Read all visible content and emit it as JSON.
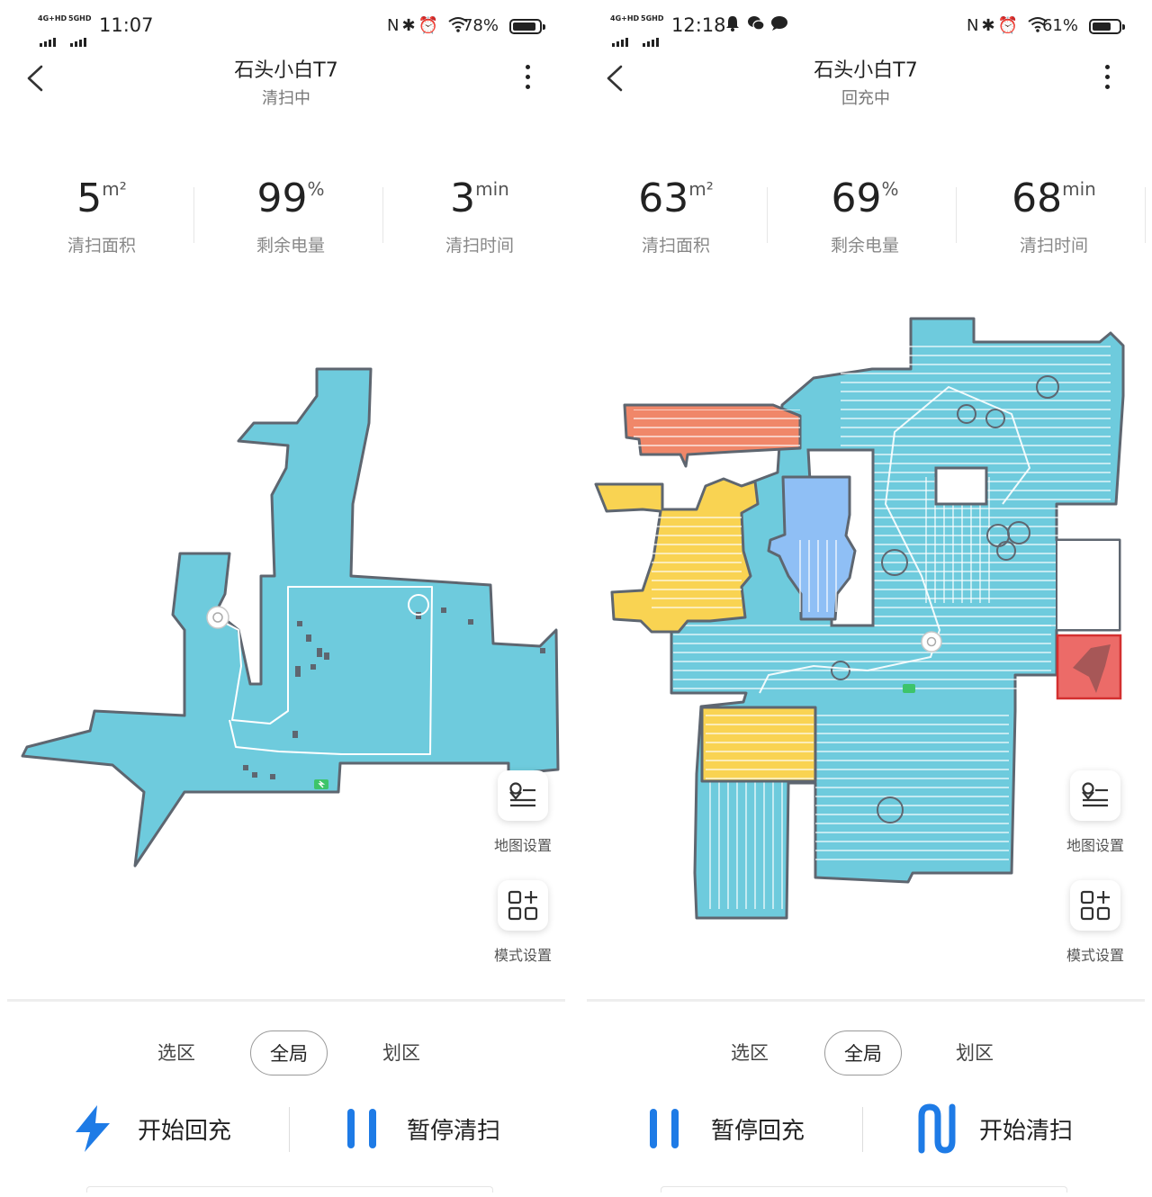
{
  "colors": {
    "accent_blue": "#1e7be6",
    "map_blue": "#6ecbdd",
    "map_wall": "#5e6670",
    "room_orange": "#f08769",
    "room_yellow": "#f9d352",
    "room_lightblue": "#8fbff5",
    "zone_red": "#e53935"
  },
  "panels": [
    {
      "status": {
        "net1": "4G+HD",
        "net2": "5GHD",
        "time": "11:07",
        "notifications": [],
        "battery": "78%",
        "battery_level": 0.78
      },
      "header": {
        "title": "石头小白T7",
        "subtitle": "清扫中"
      },
      "stats": [
        {
          "value": "5",
          "unit": "m²",
          "label": "清扫面积"
        },
        {
          "value": "99",
          "unit": "%",
          "label": "剩余电量"
        },
        {
          "value": "3",
          "unit": "min",
          "label": "清扫时间"
        }
      ],
      "side": {
        "map_settings": "地图设置",
        "mode_settings": "模式设置"
      },
      "modes": {
        "items": [
          "选区",
          "全局",
          "划区"
        ],
        "selected": "全局"
      },
      "actions": [
        {
          "label": "开始回充",
          "icon": "lightning-icon"
        },
        {
          "label": "暂停清扫",
          "icon": "pause-icon"
        }
      ]
    },
    {
      "status": {
        "net1": "4G+HD",
        "net2": "5GHD",
        "time": "12:18",
        "notifications": [
          "bell-icon",
          "wechat-icon",
          "chat-icon"
        ],
        "battery": "61%",
        "battery_level": 0.61
      },
      "header": {
        "title": "石头小白T7",
        "subtitle": "回充中"
      },
      "stats": [
        {
          "value": "63",
          "unit": "m²",
          "label": "清扫面积"
        },
        {
          "value": "69",
          "unit": "%",
          "label": "剩余电量"
        },
        {
          "value": "68",
          "unit": "min",
          "label": "清扫时间"
        }
      ],
      "side": {
        "map_settings": "地图设置",
        "mode_settings": "模式设置"
      },
      "modes": {
        "items": [
          "选区",
          "全局",
          "划区"
        ],
        "selected": "全局"
      },
      "actions": [
        {
          "label": "暂停回充",
          "icon": "pause-icon"
        },
        {
          "label": "开始清扫",
          "icon": "sweep-icon"
        }
      ]
    }
  ]
}
